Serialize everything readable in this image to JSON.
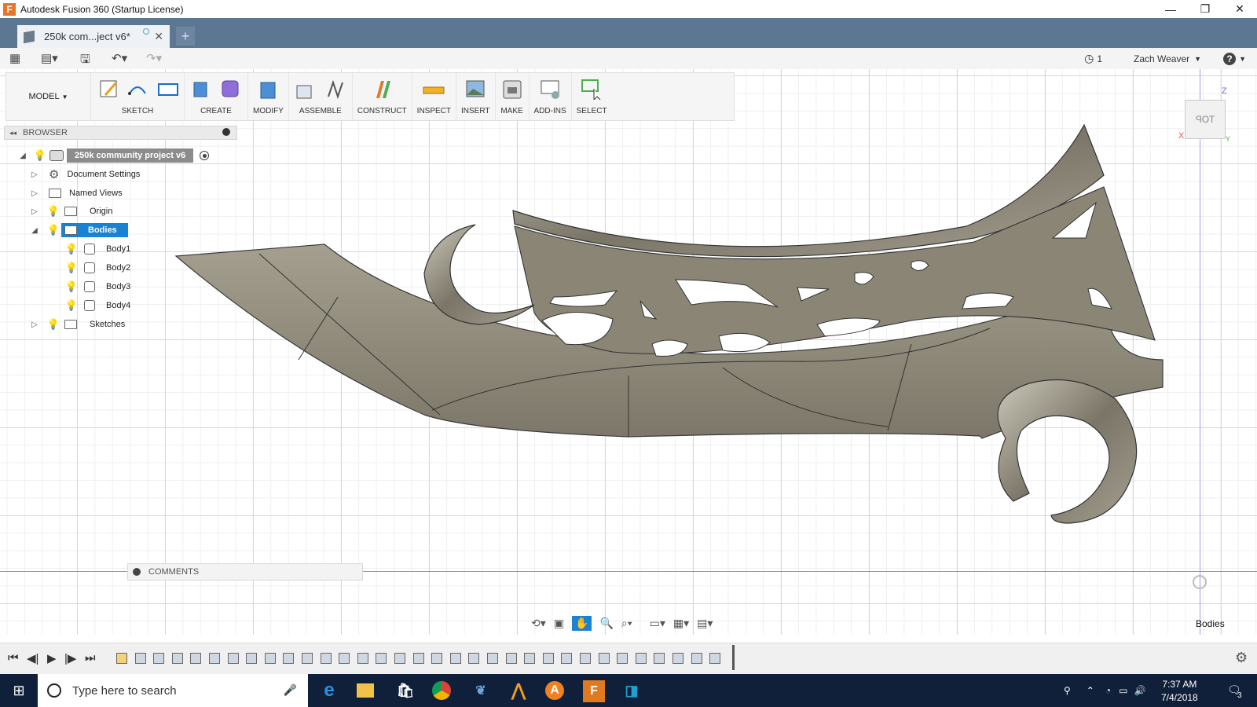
{
  "window": {
    "title": "Autodesk Fusion 360 (Startup License)",
    "app_icon": "F",
    "controls": [
      "—",
      "❐",
      "✕"
    ]
  },
  "tab": {
    "label": "250k com...ject v6*",
    "close": "✕",
    "new": "+"
  },
  "quick_access": {
    "job_count": "1",
    "user": "Zach Weaver",
    "help": "?"
  },
  "toolbar": {
    "mode": "MODEL",
    "groups": [
      "SKETCH",
      "CREATE",
      "MODIFY",
      "ASSEMBLE",
      "CONSTRUCT",
      "INSPECT",
      "INSERT",
      "MAKE",
      "ADD-INS",
      "SELECT"
    ]
  },
  "browser": {
    "title": "BROWSER",
    "root": "250k community project v6",
    "items": [
      {
        "label": "Document Settings"
      },
      {
        "label": "Named Views"
      },
      {
        "label": "Origin"
      },
      {
        "label": "Bodies"
      },
      {
        "label": "Body1"
      },
      {
        "label": "Body2"
      },
      {
        "label": "Body3"
      },
      {
        "label": "Body4"
      },
      {
        "label": "Sketches"
      }
    ]
  },
  "comments": {
    "label": "COMMENTS"
  },
  "viewcube": {
    "face": "TOP",
    "x": "X",
    "y": "Y",
    "z": "Z"
  },
  "status": {
    "selection_filter": "Bodies"
  },
  "taskbar": {
    "search_placeholder": "Type here to search",
    "time": "7:37 AM",
    "date": "7/4/2018",
    "notifications": "3"
  },
  "colors": {
    "tab_bar": "#5c7792",
    "selection": "#1a82d3",
    "taskbar": "#11203a",
    "model": "#8a8474"
  }
}
